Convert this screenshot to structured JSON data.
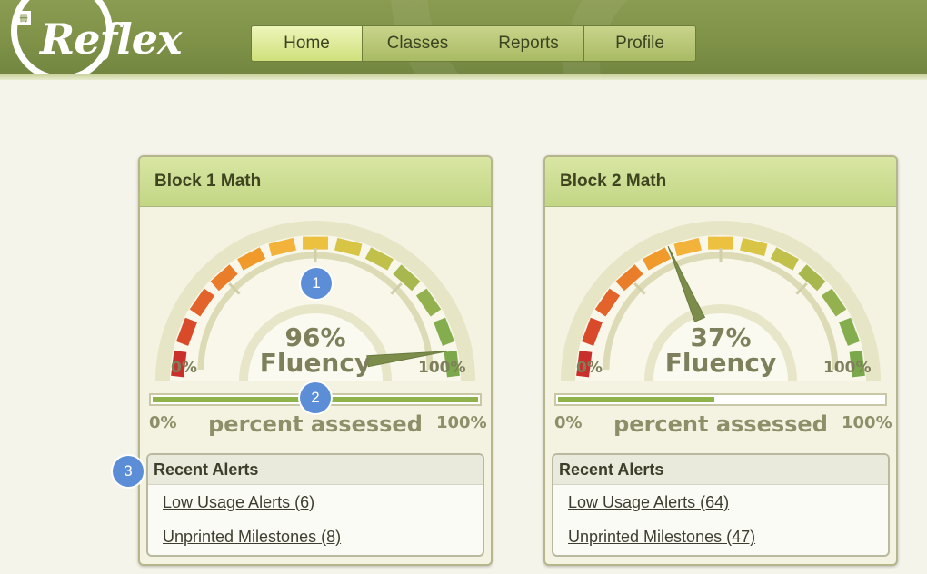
{
  "app": {
    "logo_text": "Reflex"
  },
  "nav": {
    "tabs": [
      "Home",
      "Classes",
      "Reports",
      "Profile"
    ],
    "active": "Home"
  },
  "cards": [
    {
      "title": "Block 1 Math",
      "fluency": {
        "value_label": "96%",
        "word": "Fluency",
        "value": 0.96,
        "min_label": "0%",
        "max_label": "100%"
      },
      "assessed": {
        "title": "percent assessed",
        "fraction": 1.0,
        "min_label": "0%",
        "max_label": "100%"
      },
      "alerts": {
        "title": "Recent Alerts",
        "items": [
          "Low Usage Alerts (6)",
          "Unprinted Milestones (8)"
        ]
      }
    },
    {
      "title": "Block 2 Math",
      "fluency": {
        "value_label": "37%",
        "word": "Fluency",
        "value": 0.37,
        "min_label": "0%",
        "max_label": "100%"
      },
      "assessed": {
        "title": "percent assessed",
        "fraction": 0.48,
        "min_label": "0%",
        "max_label": "100%"
      },
      "alerts": {
        "title": "Recent Alerts",
        "items": [
          "Low Usage Alerts (64)",
          "Unprinted Milestones (47)"
        ]
      }
    }
  ],
  "callouts": [
    "1",
    "2",
    "3"
  ],
  "colors": {
    "header_green": "#7e9147",
    "progress_green": "#8fb24a",
    "gauge_scale": [
      "#c9302c",
      "#d84a2a",
      "#e2642a",
      "#ea7d2a",
      "#f09a2c",
      "#f3b23a",
      "#ecc140",
      "#d8c445",
      "#c0c04a",
      "#a8b84f",
      "#93b24f",
      "#84ad4d",
      "#7aa84a"
    ]
  }
}
